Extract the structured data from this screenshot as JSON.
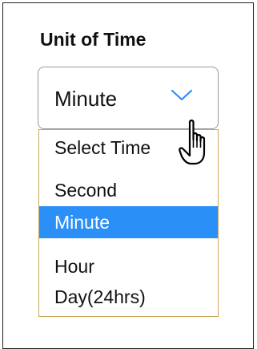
{
  "field": {
    "title": "Unit of Time",
    "selected_value": "Minute",
    "chevron_icon": "chevron-down-icon",
    "cursor_icon": "hand-pointer-icon"
  },
  "dropdown": {
    "options": [
      {
        "label": "Select Time",
        "selected": false
      },
      {
        "label": "Second",
        "selected": false
      },
      {
        "label": "Minute",
        "selected": true
      },
      {
        "label": "Hour",
        "selected": false
      },
      {
        "label": "Day(24hrs)",
        "selected": false
      }
    ]
  },
  "colors": {
    "selected_bg": "#2a8ff7",
    "selected_text": "#ffffff",
    "chevron": "#2a8ff7",
    "dropdown_border": "#c9a95a"
  }
}
